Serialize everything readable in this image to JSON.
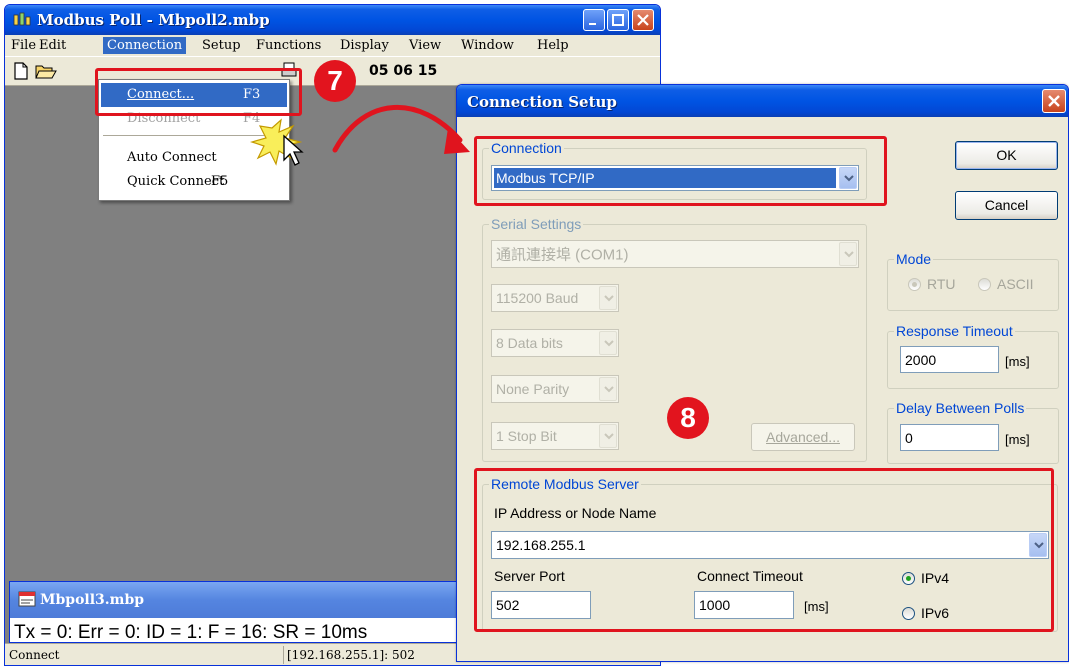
{
  "main_window": {
    "title": "Modbus Poll - Mbpoll2.mbp",
    "menu": [
      "File",
      "Edit",
      "Connection",
      "Setup",
      "Functions",
      "Display",
      "View",
      "Window",
      "Help"
    ],
    "toolbar_codes": "05 06 15"
  },
  "connection_menu": {
    "items": [
      {
        "label": "Connect...",
        "accel": "F3"
      },
      {
        "label": "Disconnect",
        "accel": "F4"
      },
      {
        "label": "Auto Connect",
        "accel": ""
      },
      {
        "label": "Quick Connect",
        "accel": "F5"
      }
    ]
  },
  "child_window": {
    "title": "Mbpoll3.mbp",
    "status_line": "Tx = 0: Err = 0: ID = 1: F = 16: SR = 10ms"
  },
  "status_bar": {
    "left": "Connect",
    "right": "[192.168.255.1]: 502"
  },
  "dialog": {
    "title": "Connection Setup",
    "connection_group": "Connection",
    "connection_value": "Modbus TCP/IP",
    "ok": "OK",
    "cancel": "Cancel",
    "serial_group": "Serial Settings",
    "port": "通訊連接埠 (COM1)",
    "baud": "115200 Baud",
    "data_bits": "8 Data bits",
    "parity": "None Parity",
    "stop_bit": "1 Stop Bit",
    "advanced": "Advanced...",
    "mode_group": "Mode",
    "mode_rtu": "RTU",
    "mode_ascii": "ASCII",
    "response_group": "Response Timeout",
    "response_value": "2000",
    "response_unit": "[ms]",
    "delay_group": "Delay Between Polls",
    "delay_value": "0",
    "delay_unit": "[ms]",
    "remote_group": "Remote Modbus Server",
    "ip_label": "IP Address or Node Name",
    "ip_value": "192.168.255.1",
    "port_label": "Server Port",
    "port_value": "502",
    "timeout_label": "Connect Timeout",
    "timeout_value": "1000",
    "timeout_unit": "[ms]",
    "ipv4": "IPv4",
    "ipv6": "IPv6"
  },
  "annotations": {
    "step7": "7",
    "step8": "8"
  },
  "colors": {
    "highlight_red": "#e0141e",
    "xp_blue": "#0054e3",
    "selection_blue": "#316ac5"
  }
}
